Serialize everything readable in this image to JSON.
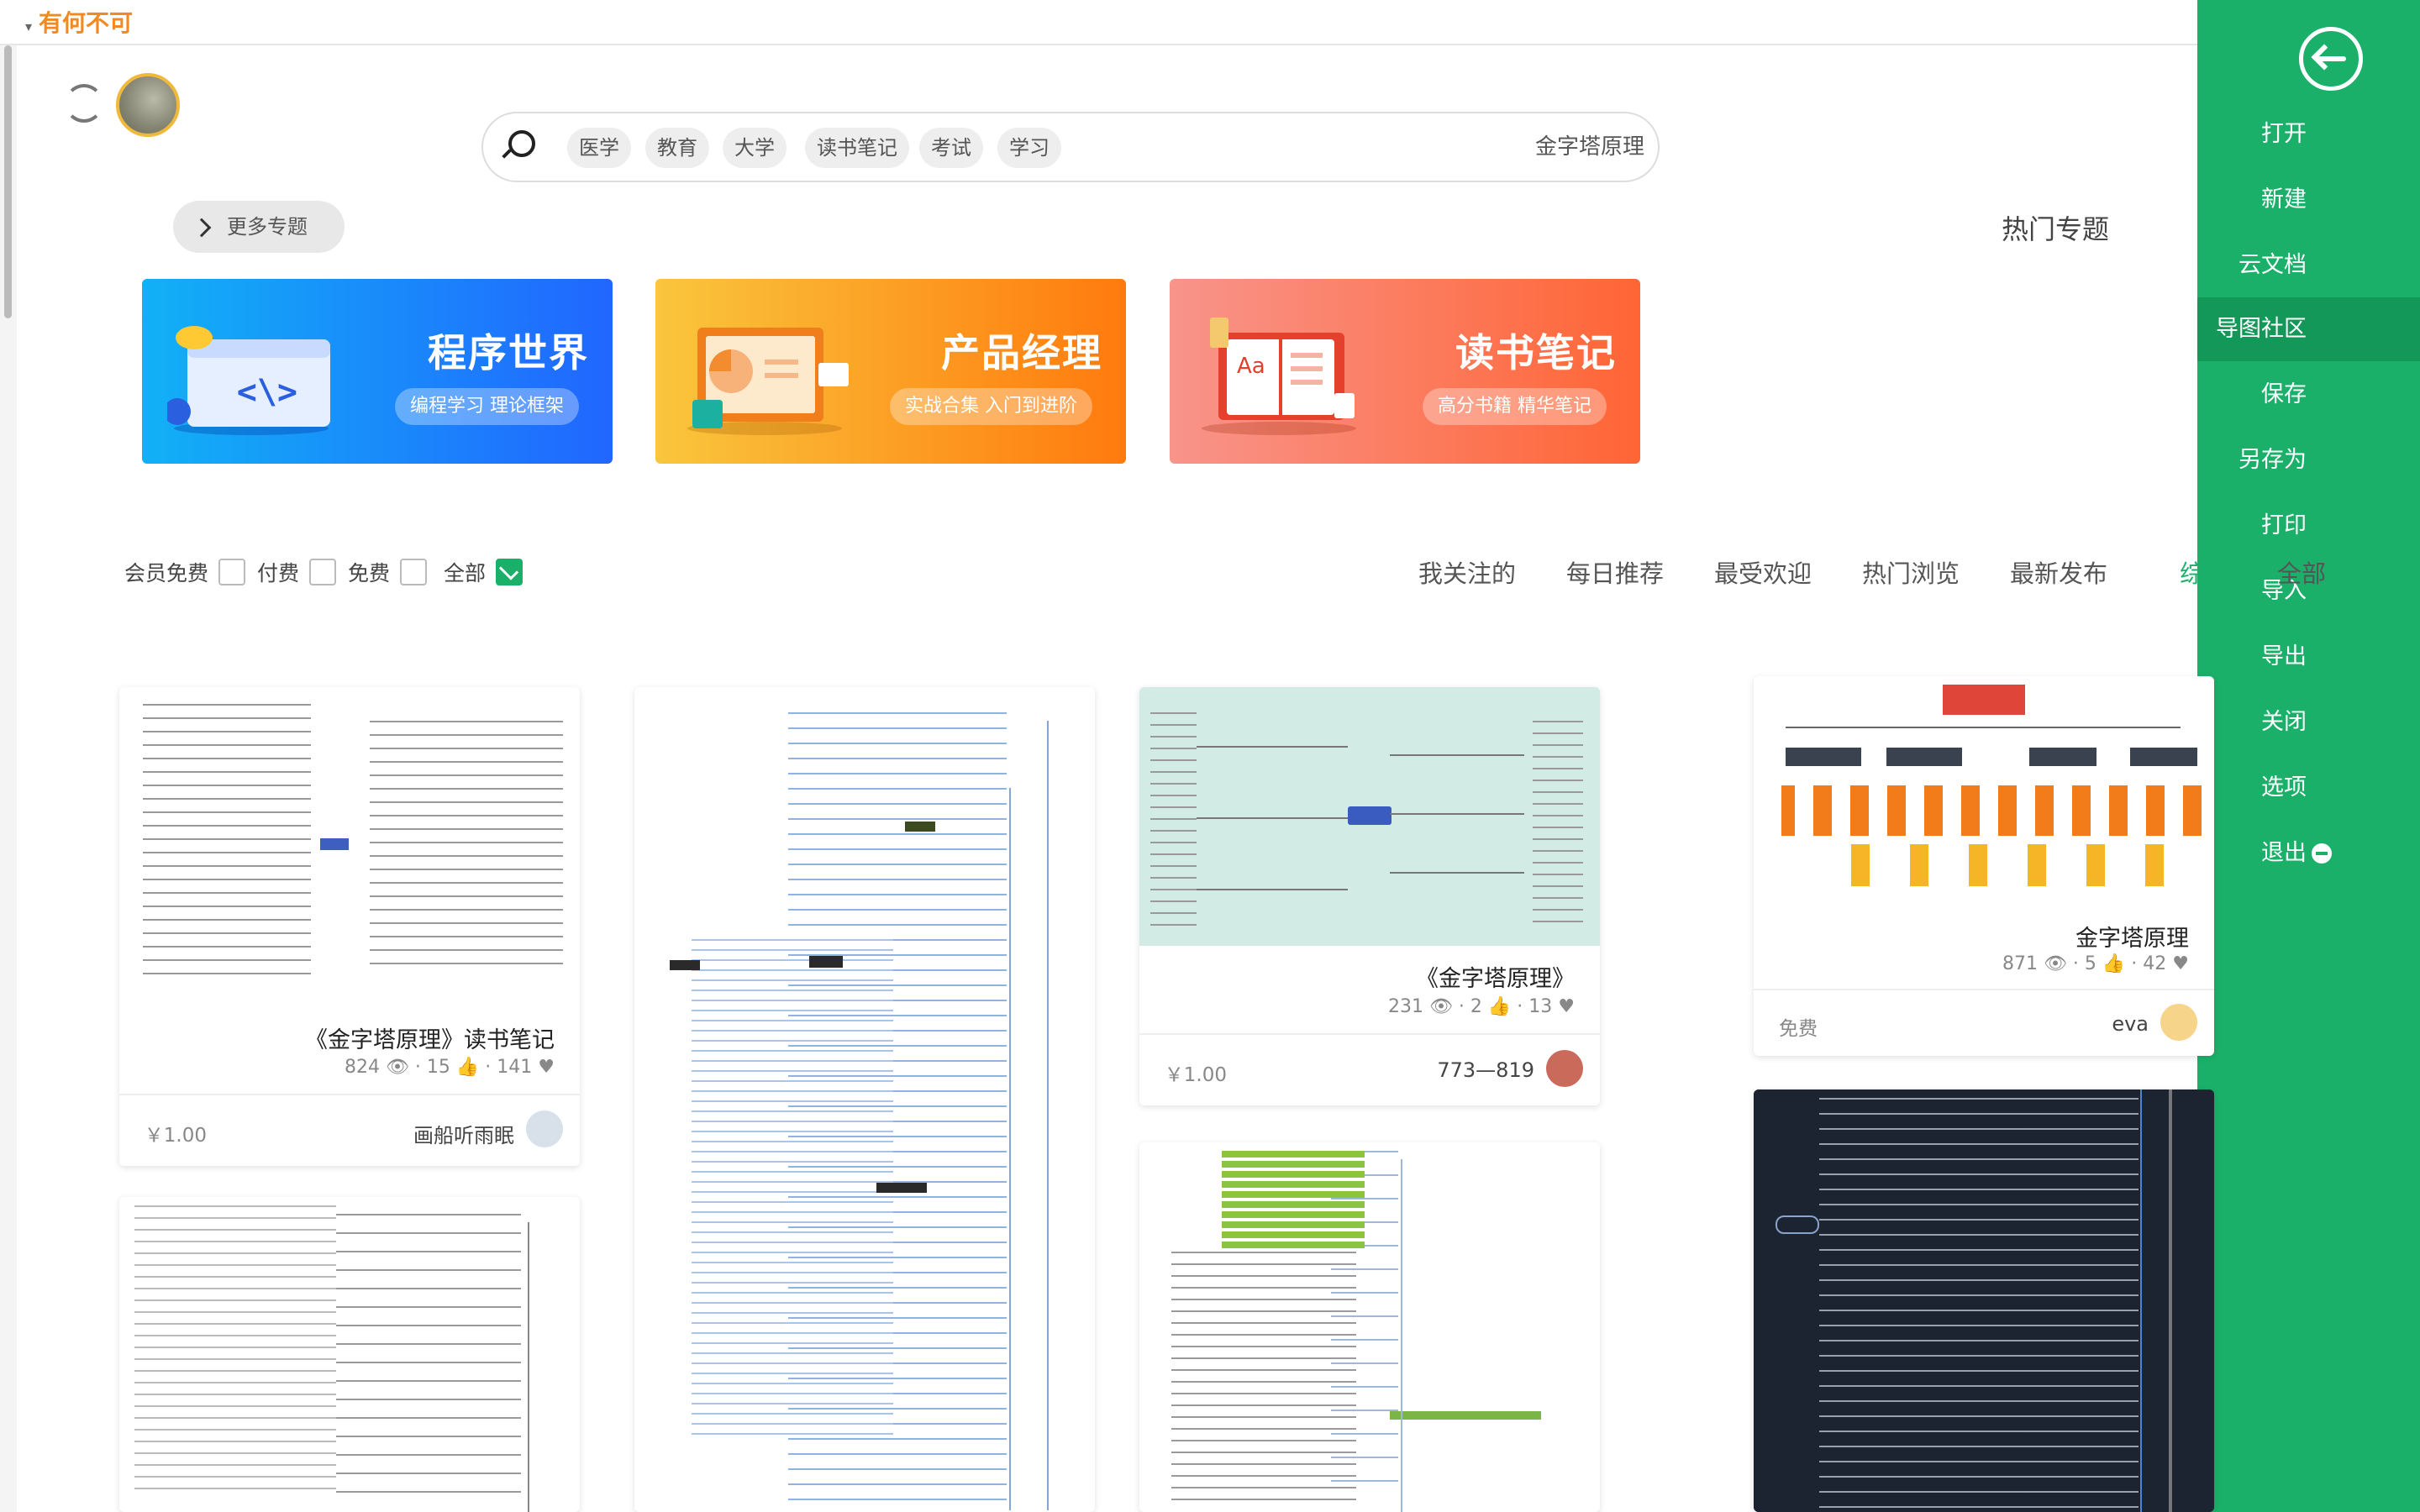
{
  "app": {
    "title": "有何不可"
  },
  "sidebar": {
    "items": [
      {
        "label": "打开"
      },
      {
        "label": "新建"
      },
      {
        "label": "云文档"
      },
      {
        "label": "导图社区"
      },
      {
        "label": "保存"
      },
      {
        "label": "另存为"
      },
      {
        "label": "打印"
      },
      {
        "label": "导入"
      },
      {
        "label": "导出"
      },
      {
        "label": "关闭"
      },
      {
        "label": "选项"
      },
      {
        "label": "退出"
      }
    ],
    "active": "导图社区"
  },
  "search": {
    "placeholder": "金字塔原理",
    "tags": [
      "学习",
      "考试",
      "读书笔记",
      "大学",
      "教育",
      "医学"
    ]
  },
  "topics": {
    "section_title": "热门专题",
    "more_label": "更多专题",
    "banners": [
      {
        "title": "读书笔记",
        "subtitle": "高分书籍 精华笔记",
        "color": "#ff6b3d"
      },
      {
        "title": "产品经理",
        "subtitle": "实战合集 入门到进阶",
        "color": "#ff8a12"
      },
      {
        "title": "程序世界",
        "subtitle": "编程学习 理论框架",
        "color": "#1a73ff"
      }
    ]
  },
  "tabs": [
    "全部",
    "综合",
    "最新发布",
    "热门浏览",
    "最受欢迎",
    "每日推荐",
    "我关注的"
  ],
  "active_tab": "综合",
  "filters": [
    {
      "label": "全部",
      "checked": true
    },
    {
      "label": "免费",
      "checked": false
    },
    {
      "label": "付费",
      "checked": false
    },
    {
      "label": "会员免费",
      "checked": false
    }
  ],
  "cards": [
    {
      "title": "金字塔原理",
      "views": "871",
      "likes": "5",
      "favs": "42",
      "author": "eva",
      "price": "免费"
    },
    {
      "title": "《金字塔原理》",
      "views": "231",
      "likes": "2",
      "favs": "13",
      "author": "773—819",
      "price": "￥1.00"
    },
    {
      "title": "",
      "views": "",
      "likes": "",
      "favs": "",
      "author": "",
      "price": ""
    },
    {
      "title": "《金字塔原理》读书笔记",
      "views": "824",
      "likes": "15",
      "favs": "141",
      "author": "画船听雨眠",
      "price": "￥1.00"
    },
    {
      "title": "",
      "views": "",
      "likes": "",
      "favs": "",
      "author": "",
      "price": ""
    },
    {
      "title": "",
      "views": "",
      "likes": "",
      "favs": "",
      "author": "",
      "price": ""
    },
    {
      "title": "",
      "views": "",
      "likes": "",
      "favs": "",
      "author": "",
      "price": ""
    }
  ]
}
